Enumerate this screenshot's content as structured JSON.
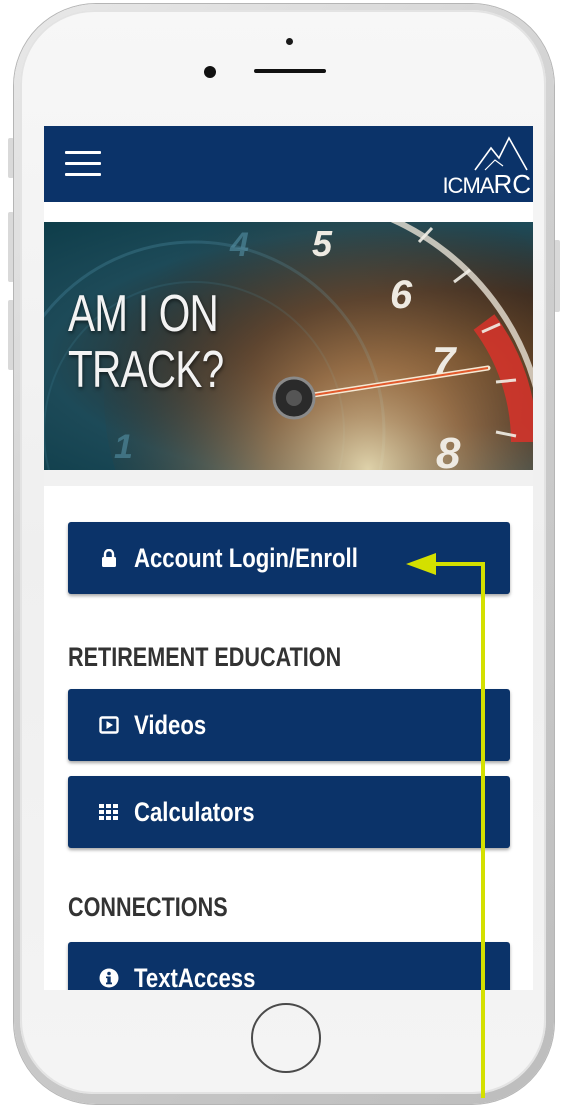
{
  "header": {
    "logo_text_main": "ICMA",
    "logo_text_rc": "RC"
  },
  "banner": {
    "title_line1": "AM I ON",
    "title_line2": "TRACK?",
    "gauge_numbers": [
      "4",
      "5",
      "6",
      "7",
      "8",
      "1"
    ]
  },
  "main": {
    "login_button": {
      "label": "Account Login/Enroll",
      "icon": "lock-icon"
    },
    "sections": [
      {
        "heading": "RETIREMENT EDUCATION",
        "items": [
          {
            "label": "Videos",
            "icon": "play-icon"
          },
          {
            "label": "Calculators",
            "icon": "grid-icon"
          }
        ]
      },
      {
        "heading": "CONNECTIONS",
        "items": [
          {
            "label": "TextAccess",
            "icon": "info-icon"
          }
        ]
      }
    ]
  },
  "colors": {
    "primary_navy": "#0b3369",
    "annotation_arrow": "#d4e000",
    "heading_text": "#333333"
  }
}
